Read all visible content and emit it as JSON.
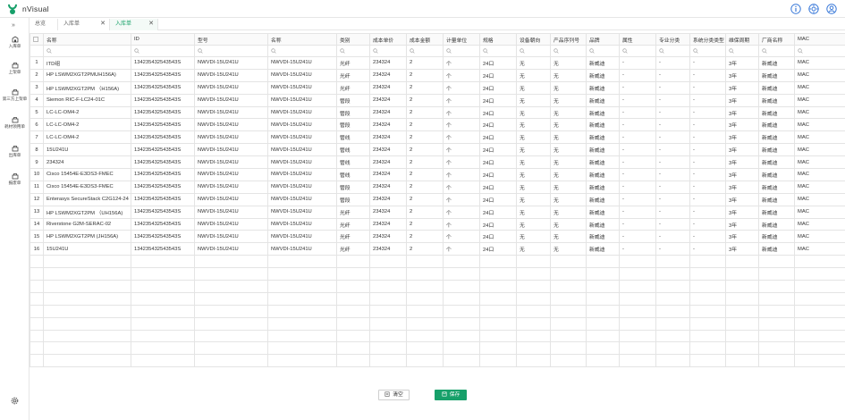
{
  "app": {
    "name": "nVisual"
  },
  "sidebar": {
    "collapse": "»",
    "items": [
      {
        "label": "入库单",
        "icon": "warehouse-in-icon"
      },
      {
        "label": "上架单",
        "icon": "shelf-icon"
      },
      {
        "label": "第三方上架单",
        "icon": "third-party-icon"
      },
      {
        "label": "耗材领用单",
        "icon": "consumable-icon"
      },
      {
        "label": "出库单",
        "icon": "warehouse-out-icon"
      },
      {
        "label": "报废单",
        "icon": "scrap-icon"
      }
    ]
  },
  "tabs": [
    {
      "label": "总览",
      "closable": false,
      "active": false
    },
    {
      "label": "入库单",
      "closable": true,
      "active": false
    },
    {
      "label": "入库单",
      "closable": true,
      "active": true
    }
  ],
  "table": {
    "headers": [
      "名称",
      "ID",
      "型号",
      "名称",
      "类别",
      "成本单价",
      "成本金额",
      "计量单位",
      "规格",
      "设备朝向",
      "产品序列号",
      "品牌",
      "属性",
      "专业分类",
      "系统分类类型",
      "维保周期",
      "厂商名称",
      "MAC"
    ],
    "rows": [
      [
        "1",
        "ITD组",
        "134235432543543S",
        "NWVDI-15U241U",
        "NWVDI-15U241U",
        "光纤",
        "234324",
        "2",
        "个",
        "24口",
        "无",
        "无",
        "新威迪",
        "-",
        "-",
        "-",
        "3年",
        "新威迪",
        "MAC"
      ],
      [
        "2",
        "HP LSWM2XGT2PMUH156A)",
        "134235432543543S",
        "NWVDI-15U241U",
        "NWVDI-15U241U",
        "光纤",
        "234324",
        "2",
        "个",
        "24口",
        "无",
        "无",
        "新威迪",
        "-",
        "-",
        "-",
        "3年",
        "新威迪",
        "MAC"
      ],
      [
        "3",
        "HP LSWM2XGT2PM （H156A)",
        "134235432543543S",
        "NWVDI-15U241U",
        "NWVDI-15U241U",
        "光纤",
        "234324",
        "2",
        "个",
        "24口",
        "无",
        "无",
        "新威迪",
        "-",
        "-",
        "-",
        "3年",
        "新威迪",
        "MAC"
      ],
      [
        "4",
        "Siemon RIC-F-LC24-01C",
        "134235432543543S",
        "NWVDI-15U241U",
        "NWVDI-15U241U",
        "管段",
        "234324",
        "2",
        "个",
        "24口",
        "无",
        "无",
        "新威迪",
        "-",
        "-",
        "-",
        "3年",
        "新威迪",
        "MAC"
      ],
      [
        "5",
        "LC-LC-OM4-2",
        "134235432543543S",
        "NWVDI-15U241U",
        "NWVDI-15U241U",
        "管段",
        "234324",
        "2",
        "个",
        "24口",
        "无",
        "无",
        "新威迪",
        "-",
        "-",
        "-",
        "3年",
        "新威迪",
        "MAC"
      ],
      [
        "6",
        "LC-LC-OM4-2",
        "134235432543543S",
        "NWVDI-15U241U",
        "NWVDI-15U241U",
        "管段",
        "234324",
        "2",
        "个",
        "24口",
        "无",
        "无",
        "新威迪",
        "-",
        "-",
        "-",
        "3年",
        "新威迪",
        "MAC"
      ],
      [
        "7",
        "LC-LC-OM4-2",
        "134235432543543S",
        "NWVDI-15U241U",
        "NWVDI-15U241U",
        "管线",
        "234324",
        "2",
        "个",
        "24口",
        "无",
        "无",
        "新威迪",
        "-",
        "-",
        "-",
        "3年",
        "新威迪",
        "MAC"
      ],
      [
        "8",
        "15U241U",
        "134235432543543S",
        "NWVDI-15U241U",
        "NWVDI-15U241U",
        "管线",
        "234324",
        "2",
        "个",
        "24口",
        "无",
        "无",
        "新威迪",
        "-",
        "-",
        "-",
        "3年",
        "新威迪",
        "MAC"
      ],
      [
        "9",
        "234324",
        "134235432543543S",
        "NWVDI-15U241U",
        "NWVDI-15U241U",
        "管线",
        "234324",
        "2",
        "个",
        "24口",
        "无",
        "无",
        "新威迪",
        "-",
        "-",
        "-",
        "3年",
        "新威迪",
        "MAC"
      ],
      [
        "10",
        "Cisco 15454E-E3DS3-FMEC",
        "134235432543543S",
        "NWVDI-15U241U",
        "NWVDI-15U241U",
        "管线",
        "234324",
        "2",
        "个",
        "24口",
        "无",
        "无",
        "新威迪",
        "-",
        "-",
        "-",
        "3年",
        "新威迪",
        "MAC"
      ],
      [
        "11",
        "Cisco 15454E-E3DS3-FMEC",
        "134235432543543S",
        "NWVDI-15U241U",
        "NWVDI-15U241U",
        "管段",
        "234324",
        "2",
        "个",
        "24口",
        "无",
        "无",
        "新威迪",
        "-",
        "-",
        "-",
        "3年",
        "新威迪",
        "MAC"
      ],
      [
        "12",
        "Enterasys SecureStack C2G124-24",
        "134235432543543S",
        "NWVDI-15U241U",
        "NWVDI-15U241U",
        "管段",
        "234324",
        "2",
        "个",
        "24口",
        "无",
        "无",
        "新威迪",
        "-",
        "-",
        "-",
        "3年",
        "新威迪",
        "MAC"
      ],
      [
        "13",
        "HP LSWM2XGT2PM （UH156A)",
        "134235432543543S",
        "NWVDI-15U241U",
        "NWVDI-15U241U",
        "光纤",
        "234324",
        "2",
        "个",
        "24口",
        "无",
        "无",
        "新威迪",
        "-",
        "-",
        "-",
        "3年",
        "新威迪",
        "MAC"
      ],
      [
        "14",
        "Riverstone G2M-SERAC-02",
        "134235432543543S",
        "NWVDI-15U241U",
        "NWVDI-15U241U",
        "光纤",
        "234324",
        "2",
        "个",
        "24口",
        "无",
        "无",
        "新威迪",
        "-",
        "-",
        "-",
        "3年",
        "新威迪",
        "MAC"
      ],
      [
        "15",
        "HP LSWM2XGT2PM (JH156A)",
        "134235432543543S",
        "NWVDI-15U241U",
        "NWVDI-15U241U",
        "光纤",
        "234324",
        "2",
        "个",
        "24口",
        "无",
        "无",
        "新威迪",
        "-",
        "-",
        "-",
        "3年",
        "新威迪",
        "MAC"
      ],
      [
        "16",
        "15U241U",
        "134235432543543S",
        "NWVDI-15U241U",
        "NWVDI-15U241U",
        "光纤",
        "234324",
        "2",
        "个",
        "24口",
        "无",
        "无",
        "新威迪",
        "-",
        "-",
        "-",
        "3年",
        "新威迪",
        "MAC"
      ]
    ],
    "empty_rows": 9
  },
  "footer": {
    "clear_label": "清空",
    "save_label": "保存"
  },
  "colors": {
    "accent": "#17a06a",
    "header_icon": "#3b7ad9",
    "border": "#e4e4e4"
  }
}
